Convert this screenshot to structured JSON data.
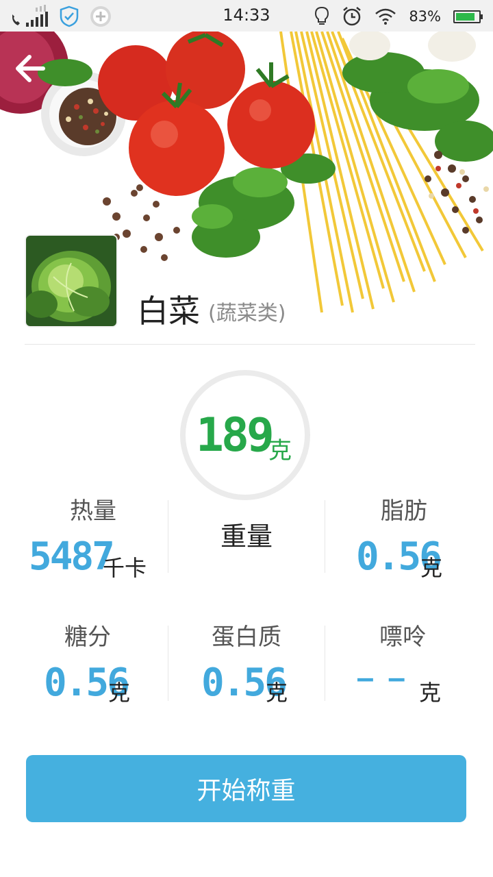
{
  "status_bar": {
    "time": "14:33",
    "battery_text": "83%",
    "battery_level": 0.83,
    "icons_left": [
      "phone-signal-icon",
      "shield-icon",
      "plus-circle-icon"
    ],
    "icons_right": [
      "bulb-icon",
      "alarm-icon",
      "wifi-icon",
      "battery-icon"
    ]
  },
  "header": {
    "back_icon": "arrow-left-icon",
    "hero_image": "vegetables-pasta-photo"
  },
  "food": {
    "name": "白菜",
    "category": "(蔬菜类)",
    "thumb_image": "cabbage-photo"
  },
  "weight": {
    "value": "189",
    "unit": "克",
    "label": "重量"
  },
  "nutrients": {
    "calories": {
      "label": "热量",
      "value": "5487",
      "unit": "千卡"
    },
    "fat": {
      "label": "脂肪",
      "value": "0.56",
      "unit": "克"
    },
    "sugar": {
      "label": "糖分",
      "value": "0.56",
      "unit": "克"
    },
    "protein": {
      "label": "蛋白质",
      "value": "0.56",
      "unit": "克"
    },
    "purine": {
      "label": "嘌呤",
      "value": "— —",
      "unit": "克"
    }
  },
  "actions": {
    "start_label": "开始称重"
  },
  "colors": {
    "accent_blue": "#45b0df",
    "value_blue": "#42a9dd",
    "weight_green": "#27a84a"
  }
}
